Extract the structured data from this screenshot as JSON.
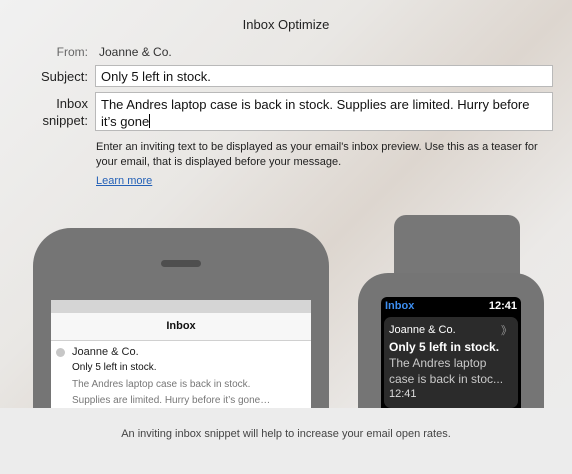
{
  "window": {
    "title": "Inbox Optimize"
  },
  "form": {
    "from_label": "From:",
    "from_value": "Joanne & Co.",
    "subject_label": "Subject:",
    "subject_value": "Only 5 left in stock.",
    "snippet_label_line1": "Inbox",
    "snippet_label_line2": "snippet:",
    "snippet_value": "The Andres laptop case is back in stock. Supplies are limited. Hurry before it’s gone",
    "help_text": "Enter an inviting text to be displayed as your email's inbox preview. Use this as a teaser for your email, that is displayed before your message.",
    "learn_more": "Learn more"
  },
  "phone_preview": {
    "header": "Inbox",
    "sender": "Joanne & Co.",
    "subject": "Only 5 left in stock.",
    "snippet_line1": "The Andres laptop case is back in stock.",
    "snippet_line2": "Supplies are limited. Hurry before it’s gone…"
  },
  "watch_preview": {
    "app_label": "Inbox",
    "time": "12:41",
    "sender": "Joanne & Co.",
    "chevron": "》",
    "subject": "Only 5 left in stock.",
    "snippet_line1": "The Andres laptop",
    "snippet_line2": "case is back in stoc...",
    "received_time": "12:41"
  },
  "footer": {
    "text": "An inviting inbox snippet will help to increase your email open rates."
  },
  "colors": {
    "link": "#2461b7",
    "watch_accent": "#3d8ef0",
    "device_gray": "#757575"
  }
}
